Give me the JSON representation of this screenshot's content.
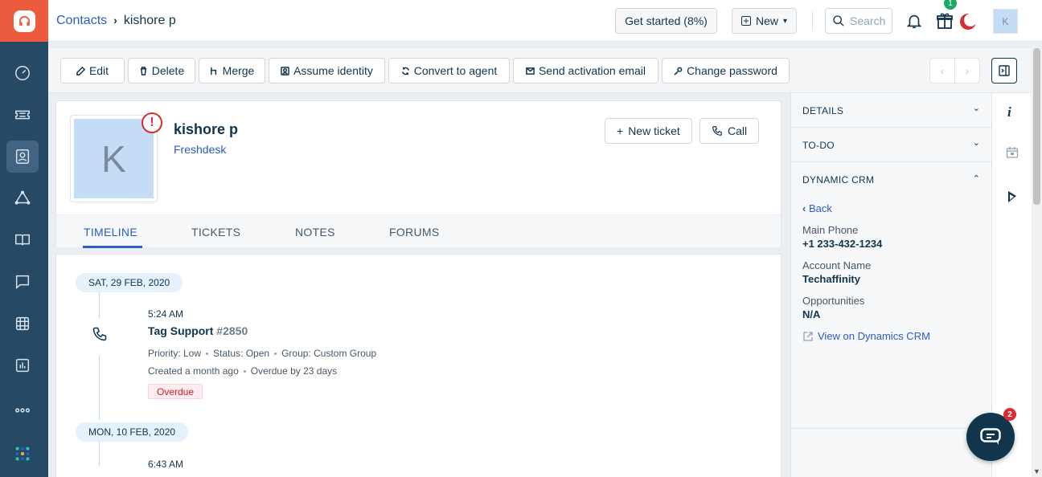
{
  "breadcrumb": {
    "parent": "Contacts",
    "current": "kishore p"
  },
  "topbar": {
    "get_started": "Get started (8%)",
    "new_label": "New",
    "search_placeholder": "Search",
    "gift_badge": "1",
    "user_initial": "K"
  },
  "actions": [
    "Edit",
    "Delete",
    "Merge",
    "Assume identity",
    "Convert to agent",
    "Send activation email",
    "Change password"
  ],
  "contact": {
    "initial": "K",
    "warning": "!",
    "name": "kishore p",
    "company": "Freshdesk",
    "new_ticket": "New ticket",
    "call": "Call"
  },
  "tabs": [
    "TIMELINE",
    "TICKETS",
    "NOTES",
    "FORUMS"
  ],
  "timeline": [
    {
      "date": "SAT, 29 FEB, 2020",
      "time": "5:24 AM",
      "title": "Tag Support",
      "ticket_no": "#2850",
      "priority": "Priority: Low",
      "status": "Status: Open",
      "group": "Group: Custom Group",
      "created": "Created a month ago",
      "overdue_by": "Overdue by 23 days",
      "badge": "Overdue"
    },
    {
      "date": "MON, 10 FEB, 2020",
      "time": "6:43 AM"
    }
  ],
  "right_panel": {
    "details": "DETAILS",
    "todo": "TO-DO",
    "crm": "DYNAMIC CRM",
    "back": "Back",
    "fields": [
      {
        "label": "Main Phone",
        "value": "+1 233-432-1234"
      },
      {
        "label": "Account Name",
        "value": "Techaffinity"
      },
      {
        "label": "Opportunities",
        "value": "N/A"
      }
    ],
    "crm_link": "View on Dynamics CRM"
  },
  "chat_badge": "2",
  "colors": {
    "brand": "#ed5b3e",
    "sidebar": "#264966",
    "link": "#2c5cc5",
    "danger": "#d72d30"
  }
}
